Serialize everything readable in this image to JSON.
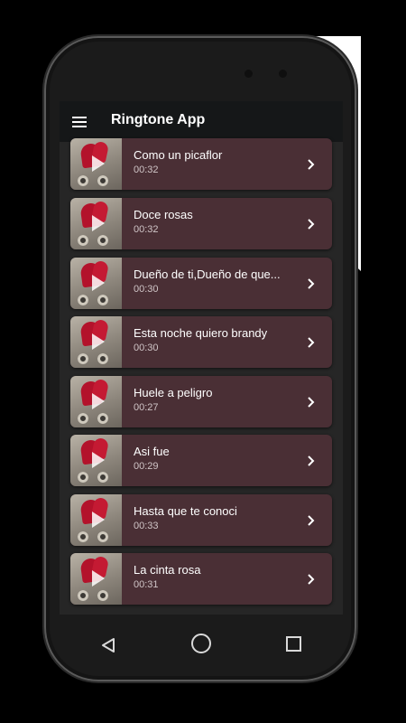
{
  "app": {
    "title": "Ringtone App"
  },
  "colors": {
    "appbar": "#151718",
    "card": "#4a2f35",
    "screen_bg": "#262626",
    "text": "#ffffff"
  },
  "icons": {
    "menu": "hamburger-menu-icon",
    "chevron": "chevron-right-icon",
    "play": "play-icon"
  },
  "songs": [
    {
      "title": "Como un picaflor",
      "duration": "00:32"
    },
    {
      "title": "Doce rosas",
      "duration": "00:32"
    },
    {
      "title": "Dueño de ti,Dueño de que...",
      "duration": "00:30"
    },
    {
      "title": "Esta noche quiero brandy",
      "duration": "00:30"
    },
    {
      "title": "Huele a peligro",
      "duration": "00:27"
    },
    {
      "title": "Asi fue",
      "duration": "00:29"
    },
    {
      "title": "Hasta que te conoci",
      "duration": "00:33"
    },
    {
      "title": "La cinta rosa",
      "duration": "00:31"
    }
  ],
  "navbar": {
    "back": "back-triangle-icon",
    "home": "home-circle-icon",
    "recents": "recents-square-icon"
  }
}
